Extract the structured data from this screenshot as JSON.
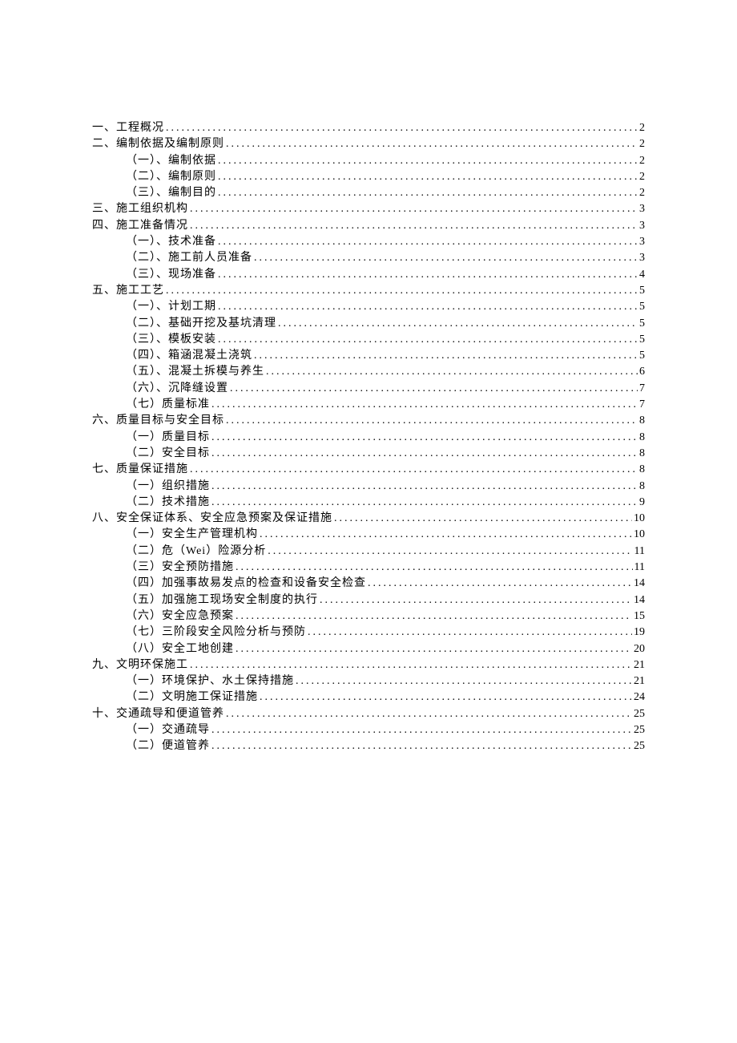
{
  "toc": [
    {
      "level": 1,
      "title": "一、工程概况",
      "page": "2"
    },
    {
      "level": 1,
      "title": "二、编制依据及编制原则",
      "page": "2"
    },
    {
      "level": 2,
      "title": "（一）、编制依据",
      "page": "2"
    },
    {
      "level": 2,
      "title": "（二）、编制原则",
      "page": "2"
    },
    {
      "level": 2,
      "title": "（三）、编制目的",
      "page": "2"
    },
    {
      "level": 1,
      "title": "三、施工组织机构",
      "page": "3"
    },
    {
      "level": 1,
      "title": "四、施工准备情况",
      "page": "3"
    },
    {
      "level": 2,
      "title": "（一）、技术准备",
      "page": "3"
    },
    {
      "level": 2,
      "title": "（二）、施工前人员准备",
      "page": "3"
    },
    {
      "level": 2,
      "title": "（三）、现场准备",
      "page": "4"
    },
    {
      "level": 1,
      "title": "五、施工工艺",
      "page": "5"
    },
    {
      "level": 2,
      "title": "（一）、计划工期",
      "page": "5"
    },
    {
      "level": 2,
      "title": "（二）、基础开挖及基坑清理",
      "page": "5"
    },
    {
      "level": 2,
      "title": "（三）、模板安装",
      "page": "5"
    },
    {
      "level": 2,
      "title": "（四）、箱涵混凝土浇筑",
      "page": "5"
    },
    {
      "level": 2,
      "title": "（五）、混凝土拆模与养生",
      "page": "6"
    },
    {
      "level": 2,
      "title": "（六）、沉降缝设置",
      "page": "7"
    },
    {
      "level": 2,
      "title": "（七）质量标准",
      "page": "7"
    },
    {
      "level": 1,
      "title": "六、质量目标与安全目标",
      "page": "8"
    },
    {
      "level": 2,
      "title": "（一）质量目标",
      "page": "8"
    },
    {
      "level": 2,
      "title": "（二）安全目标",
      "page": "8"
    },
    {
      "level": 1,
      "title": "七、质量保证措施",
      "page": "8"
    },
    {
      "level": 2,
      "title": "（一）组织措施",
      "page": "8"
    },
    {
      "level": 2,
      "title": "（二）技术措施",
      "page": "9"
    },
    {
      "level": 1,
      "title": "八、安全保证体系、安全应急预案及保证措施",
      "page": "10"
    },
    {
      "level": 2,
      "title": "（一）安全生产管理机构",
      "page": "10"
    },
    {
      "level": 2,
      "title": "（二）危（Wei）险源分析",
      "page": "11"
    },
    {
      "level": 2,
      "title": "（三）安全预防措施",
      "page": "11"
    },
    {
      "level": 2,
      "title": "（四）加强事故易发点的检查和设备安全检查",
      "page": "14"
    },
    {
      "level": 2,
      "title": "（五）加强施工现场安全制度的执行",
      "page": "14"
    },
    {
      "level": 2,
      "title": "（六）安全应急预案",
      "page": "15"
    },
    {
      "level": 2,
      "title": "（七）三阶段安全风险分析与预防",
      "page": "19"
    },
    {
      "level": 2,
      "title": "（八）安全工地创建",
      "page": "20"
    },
    {
      "level": 1,
      "title": "九、文明环保施工",
      "page": "21"
    },
    {
      "level": 2,
      "title": "（一）环境保护、水土保持措施",
      "page": "21"
    },
    {
      "level": 2,
      "title": "（二）文明施工保证措施",
      "page": "24"
    },
    {
      "level": 1,
      "title": "十、交通疏导和便道管养",
      "page": "25"
    },
    {
      "level": 2,
      "title": "（一）交通疏导",
      "page": "25"
    },
    {
      "level": 2,
      "title": "（二）便道管养",
      "page": "25"
    }
  ]
}
